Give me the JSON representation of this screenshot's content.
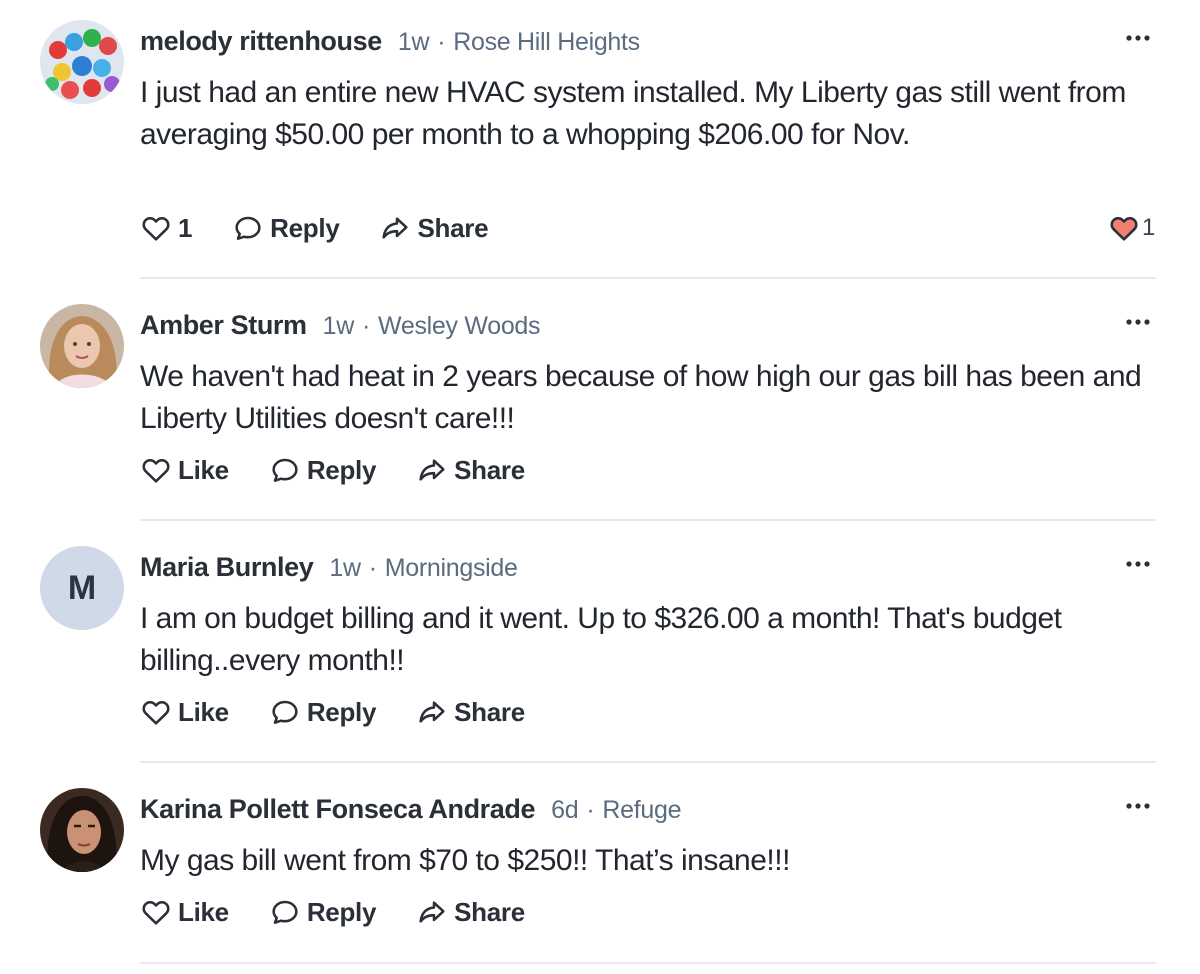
{
  "comments": [
    {
      "author": "melody rittenhouse",
      "age": "1w",
      "separator": "·",
      "location": "Rose Hill Heights",
      "text": "I just had an entire new HVAC system installed.  My Liberty gas still went from averaging $50.00 per month to a whopping $206.00 for Nov.",
      "like_label": "1",
      "reply_label": "Reply",
      "share_label": "Share",
      "reaction_count": "1",
      "avatar": "photo"
    },
    {
      "author": "Amber Sturm",
      "age": "1w",
      "separator": "·",
      "location": "Wesley Woods",
      "text": "We haven't had heat in 2 years because of how high our gas bill has been and Liberty Utilities doesn't care!!!",
      "like_label": "Like",
      "reply_label": "Reply",
      "share_label": "Share",
      "avatar": "photo"
    },
    {
      "author": "Maria Burnley",
      "age": "1w",
      "separator": "·",
      "location": "Morningside",
      "text": "I am on budget billing and it went. Up to $326.00  a month! That's budget billing..every month!!",
      "like_label": "Like",
      "reply_label": "Reply",
      "share_label": "Share",
      "avatar_initial": "M"
    },
    {
      "author": "Karina Pollett Fonseca Andrade",
      "age": "6d",
      "separator": "·",
      "location": "Refuge",
      "text": "My gas bill went from $70 to $250!! That’s insane!!!",
      "like_label": "Like",
      "reply_label": "Reply",
      "share_label": "Share",
      "avatar": "photo"
    }
  ],
  "icons": {
    "more": "more-horizontal-icon",
    "like": "heart-outline-icon",
    "reply": "speech-bubble-icon",
    "share": "share-arrow-icon",
    "reaction": "heart-filled-icon"
  },
  "colors": {
    "text": "#22262e",
    "meta": "#5b6b80",
    "reaction_heart": "#f0806f",
    "initial_avatar_bg": "#cfd9e8",
    "divider": "#e7e9ee"
  }
}
